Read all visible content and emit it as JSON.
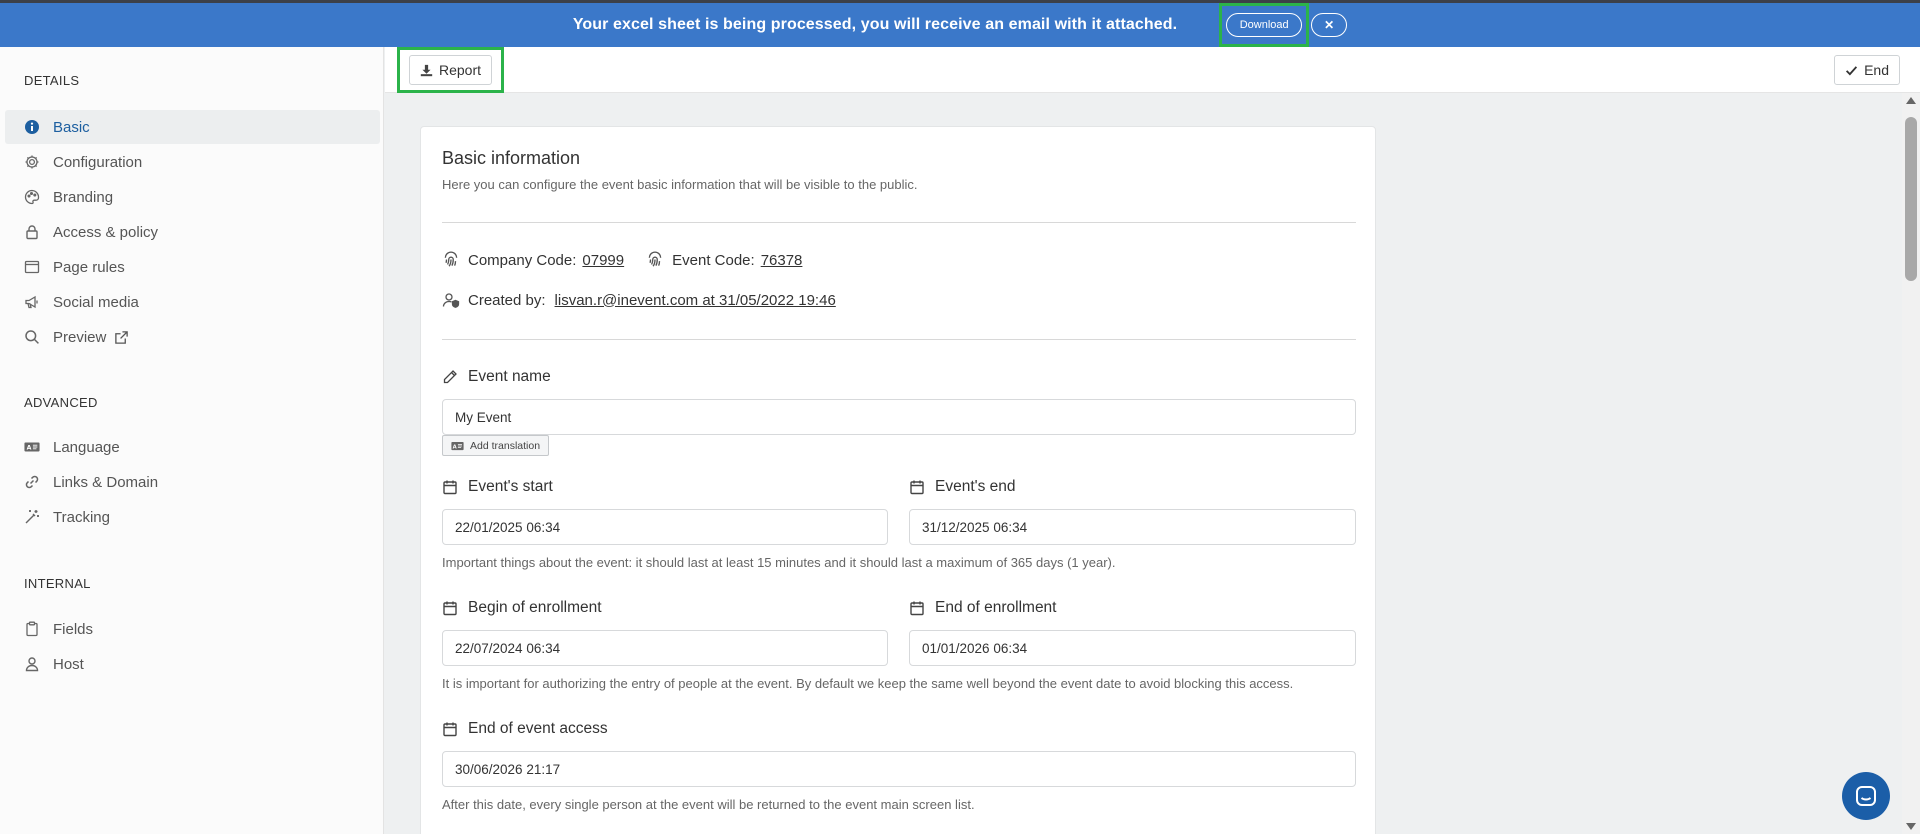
{
  "banner": {
    "message": "Your excel sheet is being processed, you will receive an email with it attached.",
    "download_label": "Download",
    "close_label": "✕"
  },
  "sidebar": {
    "details_title": "DETAILS",
    "details_items": [
      {
        "label": "Basic",
        "icon": "info-icon",
        "active": true
      },
      {
        "label": "Configuration",
        "icon": "gear-icon"
      },
      {
        "label": "Branding",
        "icon": "palette-icon"
      },
      {
        "label": "Access & policy",
        "icon": "lock-icon"
      },
      {
        "label": "Page rules",
        "icon": "window-icon"
      },
      {
        "label": "Social media",
        "icon": "megaphone-icon"
      },
      {
        "label": "Preview",
        "icon": "search-icon"
      }
    ],
    "advanced_title": "ADVANCED",
    "advanced_items": [
      {
        "label": "Language",
        "icon": "language-icon"
      },
      {
        "label": "Links & Domain",
        "icon": "link-icon"
      },
      {
        "label": "Tracking",
        "icon": "wand-icon"
      }
    ],
    "internal_title": "INTERNAL",
    "internal_items": [
      {
        "label": "Fields",
        "icon": "clipboard-icon"
      },
      {
        "label": "Host",
        "icon": "user-icon"
      }
    ]
  },
  "toolbar": {
    "report_label": "Report",
    "end_label": "End"
  },
  "card": {
    "title": "Basic information",
    "subtitle": "Here you can configure the event basic information that will be visible to the public.",
    "company_code_label": "Company Code:",
    "company_code": "07999",
    "event_code_label": "Event Code:",
    "event_code": "76378",
    "created_by_label": "Created by:",
    "created_by": "lisvan.r@inevent.com at 31/05/2022 19:46",
    "event_name_label": "Event name",
    "event_name_value": "My Event",
    "add_translation_label": "Add translation",
    "event_start_label": "Event's start",
    "event_start_value": "22/01/2025 06:34",
    "event_end_label": "Event's end",
    "event_end_value": "31/12/2025 06:34",
    "event_dates_hint": "Important things about the event: it should last at least 15 minutes and it should last a maximum of 365 days (1 year).",
    "enroll_begin_label": "Begin of enrollment",
    "enroll_begin_value": "22/07/2024 06:34",
    "enroll_end_label": "End of enrollment",
    "enroll_end_value": "01/01/2026 06:34",
    "enroll_hint": "It is important for authorizing the entry of people at the event. By default we keep the same well beyond the event date to avoid blocking this access.",
    "access_end_label": "End of event access",
    "access_end_value": "30/06/2026 21:17",
    "access_hint": "After this date, every single person at the event will be returned to the event main screen list."
  },
  "colors": {
    "banner": "#3b78c9",
    "highlight": "#2bb34a",
    "active_nav": "#1d5fa0",
    "chat": "#1b5ea8"
  }
}
